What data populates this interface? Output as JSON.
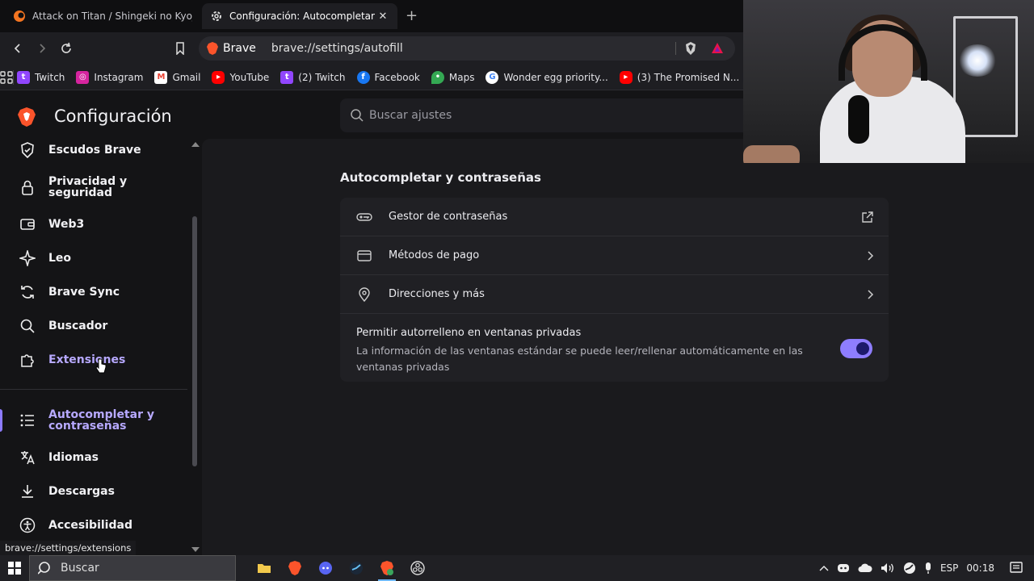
{
  "tabs": [
    {
      "title": "Attack on Titan / Shingeki no Kyojin /",
      "favicon": "crunchyroll-icon",
      "active": false
    },
    {
      "title": "Configuración: Autocompletar y",
      "favicon": "gear-icon",
      "active": true
    }
  ],
  "toolbar": {
    "brand_label": "Brave",
    "url": "brave://settings/autofill"
  },
  "bookmarks": [
    {
      "label": "Twitch",
      "icon": "twitch-icon",
      "color": "#9146ff"
    },
    {
      "label": "Instagram",
      "icon": "instagram-icon",
      "color": "#d6249f"
    },
    {
      "label": "Gmail",
      "icon": "gmail-icon",
      "color": "#ea4335"
    },
    {
      "label": "YouTube",
      "icon": "youtube-icon",
      "color": "#ff0000"
    },
    {
      "label": "(2) Twitch",
      "icon": "twitch-icon",
      "color": "#9146ff"
    },
    {
      "label": "Facebook",
      "icon": "facebook-icon",
      "color": "#1877f2"
    },
    {
      "label": "Maps",
      "icon": "maps-icon",
      "color": "#34a853"
    },
    {
      "label": "Wonder egg priority...",
      "icon": "google-icon",
      "color": "#ffffff"
    },
    {
      "label": "(3) The Promised N...",
      "icon": "youtube-icon",
      "color": "#ff0000"
    }
  ],
  "settings": {
    "title": "Configuración",
    "search_placeholder": "Buscar ajustes"
  },
  "sidebar": {
    "items": [
      {
        "label": "Escudos Brave",
        "icon": "shield-icon"
      },
      {
        "label": "Privacidad y\nseguridad",
        "icon": "lock-icon"
      },
      {
        "label": "Web3",
        "icon": "wallet-icon"
      },
      {
        "label": "Leo",
        "icon": "sparkle-icon"
      },
      {
        "label": "Brave Sync",
        "icon": "sync-icon"
      },
      {
        "label": "Buscador",
        "icon": "search-icon"
      },
      {
        "label": "Extensiones",
        "icon": "puzzle-icon"
      },
      {
        "label": "Autocompletar y\ncontraseñas",
        "icon": "list-icon",
        "active": true
      },
      {
        "label": "Idiomas",
        "icon": "translate-icon"
      },
      {
        "label": "Descargas",
        "icon": "download-icon"
      },
      {
        "label": "Accesibilidad",
        "icon": "accessibility-icon"
      }
    ]
  },
  "content": {
    "section_title": "Autocompletar y contraseñas",
    "rows": [
      {
        "label": "Gestor de contraseñas",
        "icon": "key-icon",
        "end": "external-link-icon"
      },
      {
        "label": "Métodos de pago",
        "icon": "credit-card-icon",
        "end": "chevron-right-icon"
      },
      {
        "label": "Direcciones y más",
        "icon": "location-pin-icon",
        "end": "chevron-right-icon"
      }
    ],
    "toggle": {
      "title": "Permitir autorrelleno en ventanas privadas",
      "description": "La información de las ventanas estándar se puede leer/rellenar automáticamente en las ventanas privadas",
      "on": true
    }
  },
  "status_url": "brave://settings/extensions",
  "taskbar": {
    "search_label": "Buscar",
    "apps": [
      "file-explorer-icon",
      "brave-icon",
      "discord-icon",
      "steam-icon",
      "brave-active-icon",
      "obs-icon"
    ],
    "language": "ESP",
    "time": "00:18"
  },
  "colors": {
    "accent": "#8e7dff",
    "active_nav": "#b7a9ff",
    "background": "#141416",
    "card": "#202024"
  }
}
